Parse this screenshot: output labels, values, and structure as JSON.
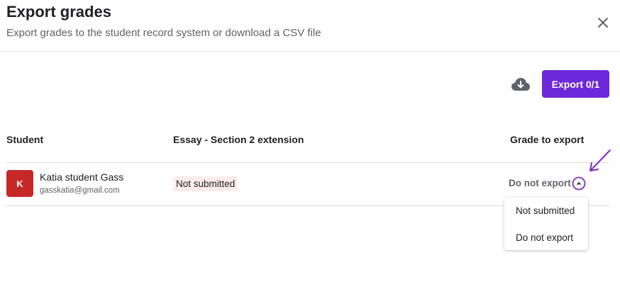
{
  "dialog": {
    "title": "Export grades",
    "subtitle": "Export grades to the student record system or download a CSV file"
  },
  "toolbar": {
    "download_icon": "cloud-download-icon",
    "export_label": "Export 0/1"
  },
  "table": {
    "headers": [
      "Student",
      "Essay - Section 2 extension",
      "Grade to export"
    ],
    "rows": [
      {
        "avatar_initial": "K",
        "name": "Katia student Gass",
        "email": "gasskatia@gmail.com",
        "status": "Not submitted",
        "grade": "Do not export"
      }
    ]
  },
  "dropdown": {
    "options": [
      "Not submitted",
      "Do not export"
    ]
  },
  "colors": {
    "accent": "#6d28d9",
    "avatar": "#c62828",
    "status_bg": "#fdecec",
    "annotation_arrow": "#7b2cbf"
  }
}
